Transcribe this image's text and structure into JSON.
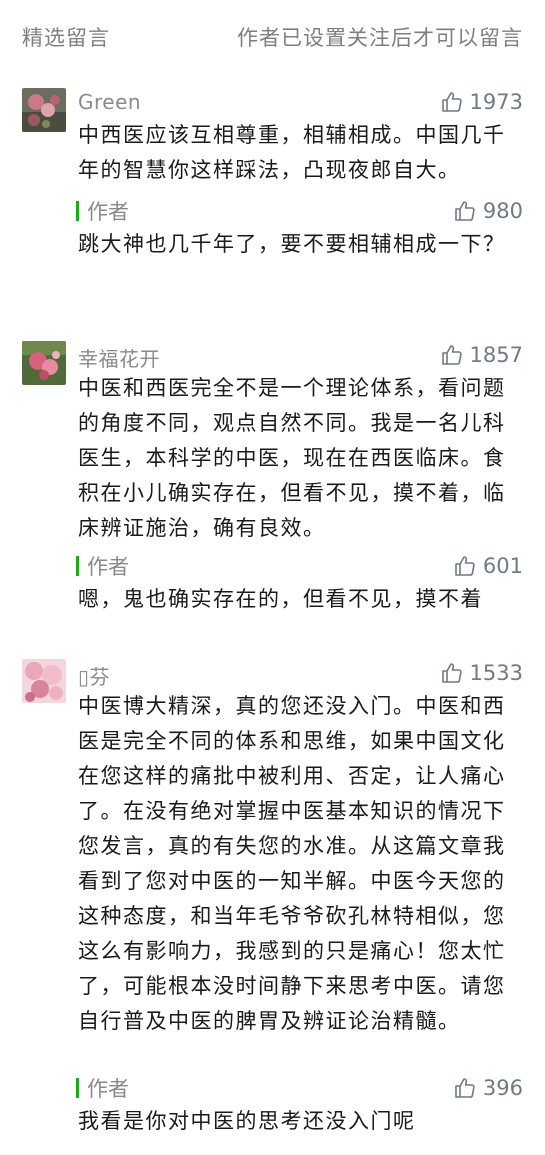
{
  "header": {
    "left_label": "精选留言",
    "right_label": "作者已设置关注后才可以留言"
  },
  "comments": [
    {
      "nickname": "Green",
      "likes": "1973",
      "text": "中西医应该互相尊重，相辅相成。中国几千年的智慧你这样踩法，凸现夜郎自大。",
      "reply": {
        "author_label": "作者",
        "likes": "980",
        "text": "跳大神也几千年了，要不要相辅相成一下？"
      }
    },
    {
      "nickname": "幸福花开",
      "likes": "1857",
      "text": "中医和西医完全不是一个理论体系，看问题的角度不同，观点自然不同。我是一名儿科医生，本科学的中医，现在在西医临床。食积在小儿确实存在，但看不见，摸不着，临床辨证施治，确有良效。",
      "reply": {
        "author_label": "作者",
        "likes": "601",
        "text": "嗯，鬼也确实存在的，但看不见，摸不着"
      }
    },
    {
      "nickname": "▯芬",
      "likes": "1533",
      "text": "中医博大精深，真的您还没入门。中医和西医是完全不同的体系和思维，如果中国文化在您这样的痛批中被利用、否定，让人痛心了。在没有绝对掌握中医基本知识的情况下您发言，真的有失您的水准。从这篇文章我看到了您对中医的一知半解。中医今天您的这种态度，和当年毛爷爷砍孔林特相似，您这么有影响力，我感到的只是痛心！您太忙了，可能根本没时间静下来思考中医。请您自行普及中医的脾胃及辨证论治精髓。",
      "reply": {
        "author_label": "作者",
        "likes": "396",
        "text": "我看是你对中医的思考还没入门呢"
      }
    }
  ]
}
